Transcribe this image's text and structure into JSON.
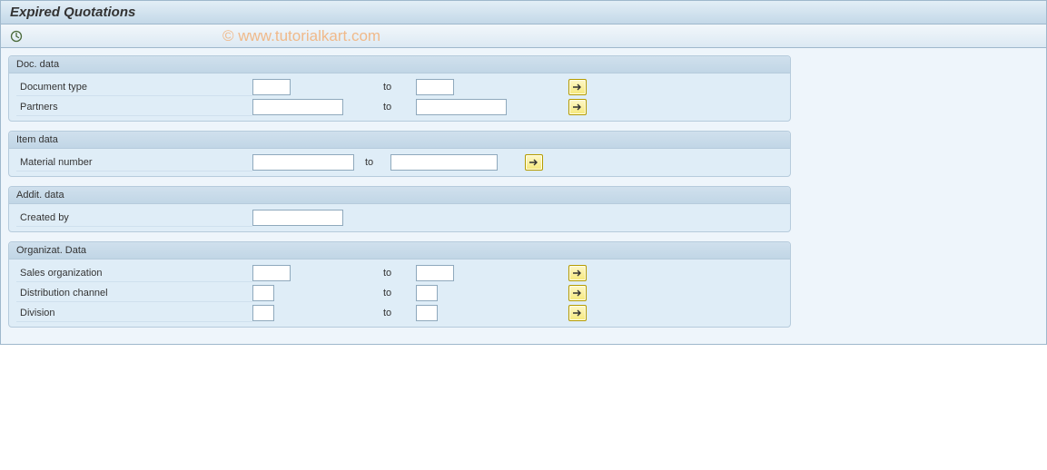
{
  "title": "Expired Quotations",
  "watermark": "© www.tutorialkart.com",
  "groups": {
    "doc": {
      "title": "Doc. data",
      "document_type": "Document type",
      "partners": "Partners",
      "to": "to"
    },
    "item": {
      "title": "Item data",
      "material_number": "Material number",
      "to": "to"
    },
    "addit": {
      "title": "Addit. data",
      "created_by": "Created by"
    },
    "org": {
      "title": "Organizat. Data",
      "sales_org": "Sales organization",
      "dist_channel": "Distribution channel",
      "division": "Division",
      "to": "to"
    }
  }
}
